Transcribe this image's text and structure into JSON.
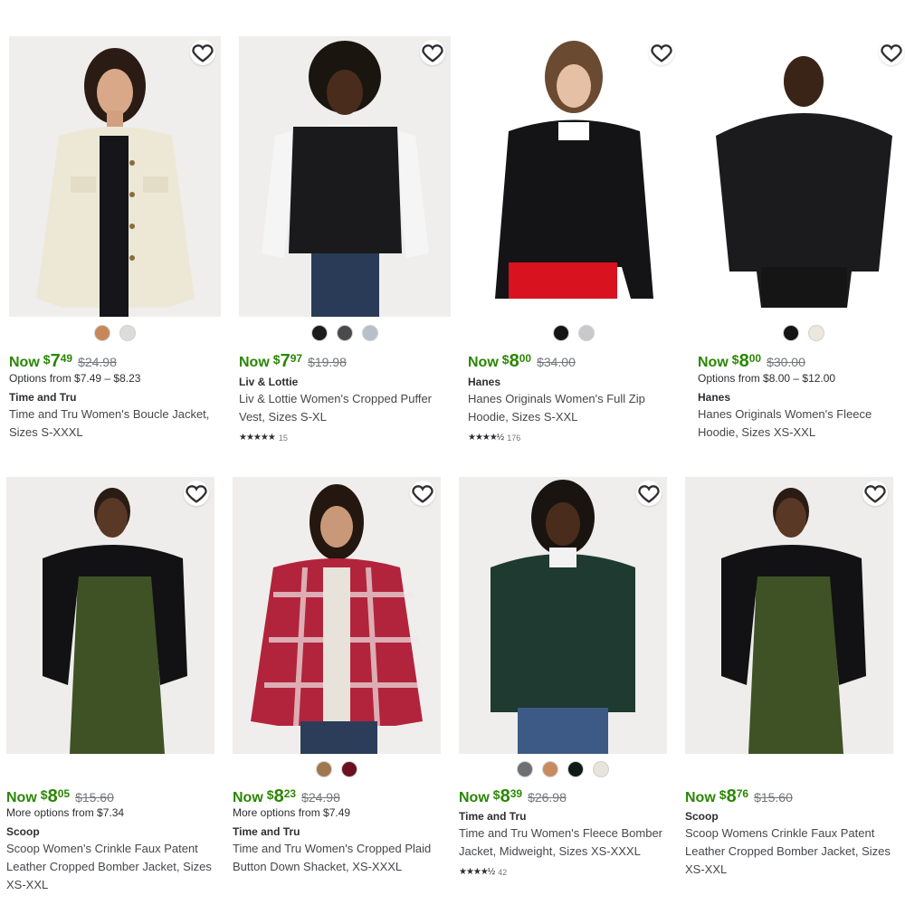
{
  "products": [
    {
      "id": "p1",
      "now_label": "Now",
      "dollars": "7",
      "cents": "49",
      "was": "$24.98",
      "options": "Options from $7.49 – $8.23",
      "brand": "Time and Tru",
      "title": "Time and Tru Women's Boucle Jacket, Sizes S-XXXL",
      "rating_count": "",
      "swatches": [
        "#c8875a",
        "#dcdcd8"
      ],
      "image": "white-boucle-jacket"
    },
    {
      "id": "p2",
      "now_label": "Now",
      "dollars": "7",
      "cents": "97",
      "was": "$19.98",
      "options": "",
      "brand": "Liv & Lottie",
      "title": "Liv & Lottie Women's Cropped Puffer Vest, Sizes S-XL",
      "rating_count": "15",
      "swatches": [
        "#1c1c1c",
        "#4a4a4c",
        "#b7c0c8"
      ],
      "image": "black-puffer-vest"
    },
    {
      "id": "p3",
      "now_label": "Now",
      "dollars": "8",
      "cents": "00",
      "was": "$34.00",
      "options": "",
      "brand": "Hanes",
      "title": "Hanes Originals Women's Full Zip Hoodie, Sizes S-XXL",
      "rating_count": "176",
      "swatches": [
        "#151515",
        "#c9c9cc"
      ],
      "image": "black-zip-hoodie"
    },
    {
      "id": "p4",
      "now_label": "Now",
      "dollars": "8",
      "cents": "00",
      "was": "$30.00",
      "options": "Options from $8.00 – $12.00",
      "brand": "Hanes",
      "title": "Hanes Originals Women's Fleece Hoodie, Sizes XS-XXL",
      "rating_count": "",
      "swatches": [
        "#151515",
        "#ece8dc"
      ],
      "image": "black-fleece-hoodie"
    },
    {
      "id": "p5",
      "now_label": "Now",
      "dollars": "8",
      "cents": "05",
      "was": "$15.60",
      "options": "More options from $7.34",
      "brand": "Scoop",
      "title": "Scoop Women's Crinkle Faux Patent Leather Cropped Bomber Jacket, Sizes XS-XXL",
      "rating_count": "",
      "swatches": [],
      "image": "black-patent-bomber"
    },
    {
      "id": "p6",
      "now_label": "Now",
      "dollars": "8",
      "cents": "23",
      "was": "$24.98",
      "options": "More options from $7.49",
      "brand": "Time and Tru",
      "title": "Time and Tru Women's Cropped Plaid Button Down Shacket, XS-XXXL",
      "rating_count": "",
      "swatches": [
        "#a0774f",
        "#6b1020"
      ],
      "image": "red-plaid-shacket"
    },
    {
      "id": "p7",
      "now_label": "Now",
      "dollars": "8",
      "cents": "39",
      "was": "$26.98",
      "options": "",
      "brand": "Time and Tru",
      "title": "Time and Tru Women's Fleece Bomber Jacket, Midweight, Sizes XS-XXXL",
      "rating_count": "42",
      "swatches": [
        "#6d6f72",
        "#c88a5e",
        "#0d1a16",
        "#e8e4da"
      ],
      "image": "green-fleece-bomber"
    },
    {
      "id": "p8",
      "now_label": "Now",
      "dollars": "8",
      "cents": "76",
      "was": "$15.60",
      "options": "",
      "brand": "Scoop",
      "title": "Scoop Womens Crinkle Faux Patent Leather Cropped Bomber Jacket, Sizes XS-XXL",
      "rating_count": "",
      "swatches": [],
      "image": "black-patent-bomber"
    }
  ],
  "icons": {
    "favorite": "heart-outline-icon",
    "rating": "star-icon"
  },
  "colors": {
    "price_green": "#2a8703",
    "text": "#2e2f32",
    "muted": "#74767c"
  }
}
